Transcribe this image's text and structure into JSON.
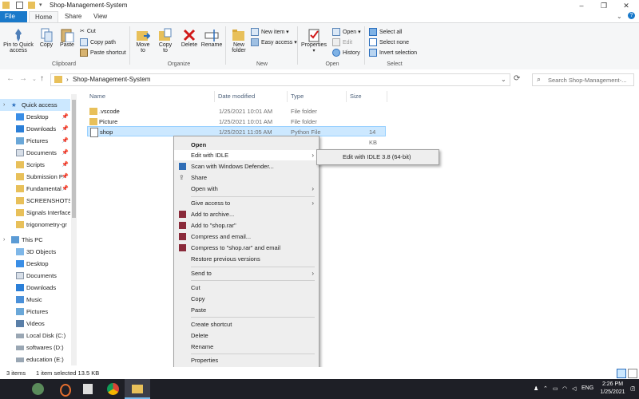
{
  "window": {
    "title": "Shop-Management-System"
  },
  "tabs": [
    "File",
    "Home",
    "Share",
    "View"
  ],
  "ribbon": {
    "clipboard": {
      "pin_label_1": "Pin to Quick",
      "pin_label_2": "access",
      "copy": "Copy",
      "paste": "Paste",
      "cut": "Cut",
      "copy_path": "Copy path",
      "paste_shortcut": "Paste shortcut",
      "group": "Clipboard"
    },
    "organize": {
      "move_1": "Move",
      "move_2": "to",
      "copy_1": "Copy",
      "copy_2": "to",
      "delete": "Delete",
      "rename": "Rename",
      "group": "Organize"
    },
    "new": {
      "new_folder_1": "New",
      "new_folder_2": "folder",
      "new_item": "New item",
      "easy_access": "Easy access",
      "group": "New"
    },
    "open": {
      "properties": "Properties",
      "open": "Open",
      "edit": "Edit",
      "history": "History",
      "group": "Open"
    },
    "select": {
      "select_all": "Select all",
      "select_none": "Select none",
      "invert": "Invert selection",
      "group": "Select"
    }
  },
  "address": {
    "path": "Shop-Management-System",
    "search_placeholder": "Search Shop-Management-..."
  },
  "nav": {
    "quick_access": "Quick access",
    "pinned": [
      "Desktop",
      "Downloads",
      "Pictures",
      "Documents",
      "Scripts",
      "Submission P",
      "Fundamental"
    ],
    "recent": [
      "SCREENSHOTS",
      "Signals Interface",
      "trigonometry-gr"
    ],
    "this_pc": "This PC",
    "pc_items": [
      "3D Objects",
      "Desktop",
      "Documents",
      "Downloads",
      "Music",
      "Pictures",
      "Videos",
      "Local Disk (C:)",
      "softwares (D:)",
      "education (E:)"
    ]
  },
  "columns": {
    "name": "Name",
    "date": "Date modified",
    "type": "Type",
    "size": "Size"
  },
  "files": [
    {
      "name": ".vscode",
      "date": "1/25/2021 10:01 AM",
      "type": "File folder",
      "size": ""
    },
    {
      "name": "Picture",
      "date": "1/25/2021 10:01 AM",
      "type": "File folder",
      "size": ""
    },
    {
      "name": "shop",
      "date": "1/25/2021 11:05 AM",
      "type": "Python File",
      "size": "14 KB"
    }
  ],
  "context_menu": {
    "open": "Open",
    "edit_idle": "Edit with IDLE",
    "defender": "Scan with Windows Defender...",
    "share": "Share",
    "open_with": "Open with",
    "give_access": "Give access to",
    "add_archive": "Add to archive...",
    "add_rar": "Add to \"shop.rar\"",
    "compress_email": "Compress and email...",
    "compress_rar_email": "Compress to \"shop.rar\" and email",
    "restore": "Restore previous versions",
    "send_to": "Send to",
    "cut": "Cut",
    "copy": "Copy",
    "paste": "Paste",
    "create_shortcut": "Create shortcut",
    "delete": "Delete",
    "rename": "Rename",
    "properties": "Properties"
  },
  "submenu": {
    "idle64": "Edit with IDLE 3.8 (64-bit)"
  },
  "status": {
    "items": "3 items",
    "selected": "1 item selected  13.5 KB"
  },
  "taskbar": {
    "time": "2:26 PM",
    "date": "1/25/2021",
    "lang": "ENG",
    "notif": "2"
  }
}
